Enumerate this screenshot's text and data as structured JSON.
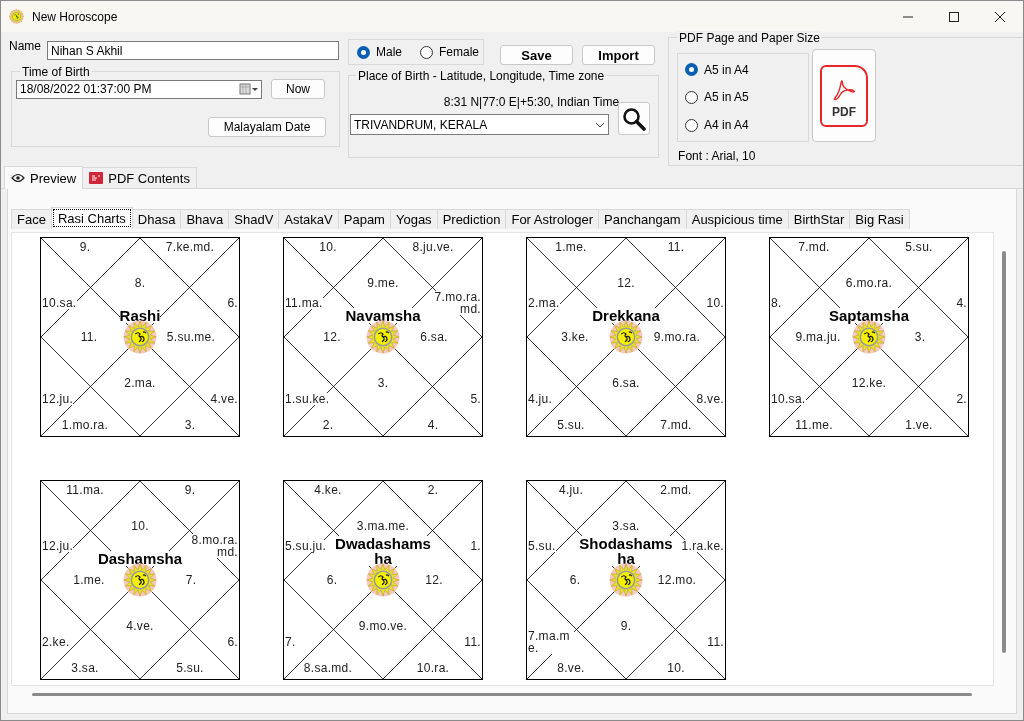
{
  "window": {
    "title": "New Horoscope"
  },
  "name": {
    "label": "Name",
    "value": "Nihan S Akhil"
  },
  "gender": [
    {
      "label": "Male",
      "selected": true
    },
    {
      "label": "Female",
      "selected": false
    }
  ],
  "actions": [
    "Save",
    "Import"
  ],
  "time_of_birth": {
    "title": "Time of Birth",
    "value": "18/08/2022  01:37:00 PM",
    "now_button": "Now",
    "malayalam_button": "Malayalam Date"
  },
  "place": {
    "title": "Place of Birth - Latitude, Longitude, Time zone",
    "coordinates": "8:31 N|77:0 E|+5:30, Indian Time",
    "value": "TRIVANDRUM, KERALA"
  },
  "pdf": {
    "title": "PDF Page and Paper Size",
    "sizes": [
      {
        "label": "A5 in A4",
        "selected": true
      },
      {
        "label": "A5 in A5",
        "selected": false
      },
      {
        "label": "A4 in A4",
        "selected": false
      }
    ],
    "button": "PDF",
    "font": "Font : Arial, 10"
  },
  "view_tabs": [
    {
      "label": "Preview",
      "selected": true,
      "kind": "eye"
    },
    {
      "label": "PDF Contents",
      "selected": false,
      "kind": "pdf"
    }
  ],
  "tabs": [
    {
      "label": "Face",
      "selected": false
    },
    {
      "label": "Rasi Charts",
      "selected": true
    },
    {
      "label": "Dhasa",
      "selected": false
    },
    {
      "label": "Bhava",
      "selected": false
    },
    {
      "label": "ShadV",
      "selected": false
    },
    {
      "label": "AstakaV",
      "selected": false
    },
    {
      "label": "Papam",
      "selected": false
    },
    {
      "label": "Yogas",
      "selected": false
    },
    {
      "label": "Prediction",
      "selected": false
    },
    {
      "label": "For Astrologer",
      "selected": false
    },
    {
      "label": "Panchangam",
      "selected": false
    },
    {
      "label": "Auspicious time",
      "selected": false
    },
    {
      "label": "BirthStar",
      "selected": false
    },
    {
      "label": "Big Rasi",
      "selected": false
    }
  ],
  "charts": [
    {
      "title": "Rashi",
      "houses": [
        "9.",
        "7.ke.md.",
        "8.",
        "10.sa.",
        "6.",
        "11.",
        "5.su.me.",
        "2.ma.",
        "12.ju.",
        "4.ve.",
        "1.mo.ra.",
        "3."
      ]
    },
    {
      "title": "Navamsha",
      "houses": [
        "10.",
        "8.ju.ve.",
        "9.me.",
        "11.ma.",
        "7.mo.ra.md.",
        "12.",
        "6.sa.",
        "3.",
        "1.su.ke.",
        "5.",
        "2.",
        "4."
      ]
    },
    {
      "title": "Drekkana",
      "houses": [
        "1.me.",
        "11.",
        "12.",
        "2.ma.",
        "10.",
        "3.ke.",
        "9.mo.ra.",
        "6.sa.",
        "4.ju.",
        "8.ve.",
        "5.su.",
        "7.md."
      ]
    },
    {
      "title": "Saptamsha",
      "houses": [
        "7.md.",
        "5.su.",
        "6.mo.ra.",
        "8.",
        "4.",
        "9.ma.ju.",
        "3.",
        "12.ke.",
        "10.sa.",
        "2.",
        "11.me.",
        "1.ve."
      ]
    },
    {
      "title": "Dashamsha",
      "houses": [
        "11.ma.",
        "9.",
        "10.",
        "12.ju.",
        "8.mo.ra.md.",
        "1.me.",
        "7.",
        "4.ve.",
        "2.ke.",
        "6.",
        "3.sa.",
        "5.su."
      ]
    },
    {
      "title": "Dwadashamsha",
      "houses": [
        "4.ke.",
        "2.",
        "3.ma.me.",
        "5.su.ju.",
        "1.",
        "6.",
        "12.",
        "9.mo.ve.",
        "7.",
        "11.",
        "8.sa.md.",
        "10.ra."
      ]
    },
    {
      "title": "Shodashamsha",
      "houses": [
        "4.ju.",
        "2.md.",
        "3.sa.",
        "5.su.",
        "1.ra.ke.",
        "6.",
        "12.mo.",
        "9.",
        "7.ma.me.",
        "11.",
        "8.ve.",
        "10."
      ]
    }
  ]
}
